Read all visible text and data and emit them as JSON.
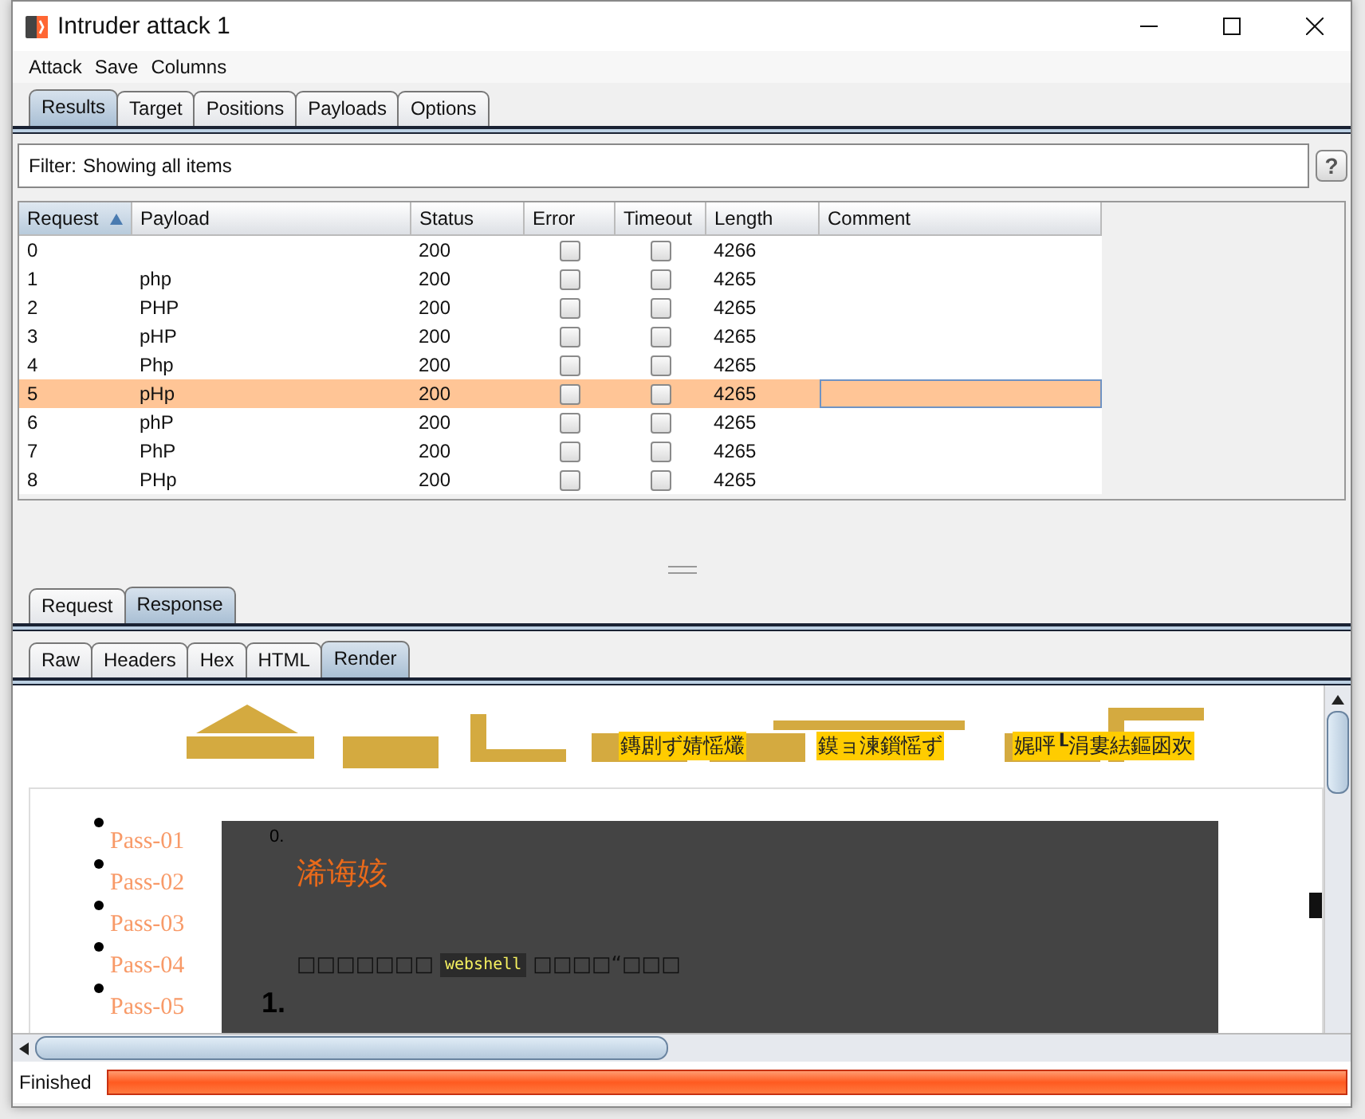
{
  "window": {
    "title": "Intruder attack 1"
  },
  "menu": [
    "Attack",
    "Save",
    "Columns"
  ],
  "tabs": [
    {
      "label": "Results",
      "selected": true
    },
    {
      "label": "Target",
      "selected": false
    },
    {
      "label": "Positions",
      "selected": false
    },
    {
      "label": "Payloads",
      "selected": false
    },
    {
      "label": "Options",
      "selected": false
    }
  ],
  "filter": {
    "label": "Filter:",
    "value": "Showing all items",
    "help": "?"
  },
  "table": {
    "columns": [
      {
        "label": "Request",
        "sorted": true
      },
      {
        "label": "Payload",
        "sorted": false
      },
      {
        "label": "Status",
        "sorted": false
      },
      {
        "label": "Error",
        "sorted": false
      },
      {
        "label": "Timeout",
        "sorted": false
      },
      {
        "label": "Length",
        "sorted": false
      },
      {
        "label": "Comment",
        "sorted": false
      }
    ],
    "rows": [
      {
        "request": "0",
        "status": "200",
        "error": false,
        "timeout": false,
        "length": "4266",
        "selected": false
      },
      {
        "request": "1",
        "payload": "php",
        "status": "200",
        "error": false,
        "timeout": false,
        "length": "4265",
        "selected": false
      },
      {
        "request": "2",
        "payload": "PHP",
        "status": "200",
        "error": false,
        "timeout": false,
        "length": "4265",
        "selected": false
      },
      {
        "request": "3",
        "payload": "pHP",
        "status": "200",
        "error": false,
        "timeout": false,
        "length": "4265",
        "selected": false
      },
      {
        "request": "4",
        "payload": "Php",
        "status": "200",
        "error": false,
        "timeout": false,
        "length": "4265",
        "selected": false
      },
      {
        "request": "5",
        "payload": "pHp",
        "status": "200",
        "error": false,
        "timeout": false,
        "length": "4265",
        "selected": true
      },
      {
        "request": "6",
        "payload": "phP",
        "status": "200",
        "error": false,
        "timeout": false,
        "length": "4265",
        "selected": false
      },
      {
        "request": "7",
        "payload": "PhP",
        "status": "200",
        "error": false,
        "timeout": false,
        "length": "4265",
        "selected": false
      },
      {
        "request": "8",
        "payload": "PHp",
        "status": "200",
        "error": false,
        "timeout": false,
        "length": "4265",
        "selected": false
      }
    ]
  },
  "message_tabs": [
    {
      "label": "Request",
      "selected": false
    },
    {
      "label": "Response",
      "selected": true
    }
  ],
  "view_tabs": [
    {
      "label": "Raw",
      "selected": false
    },
    {
      "label": "Headers",
      "selected": false
    },
    {
      "label": "Hex",
      "selected": false
    },
    {
      "label": "HTML",
      "selected": false
    },
    {
      "label": "Render",
      "selected": true
    }
  ],
  "render": {
    "logo_links": [
      "鏄剧ず婧愮爜",
      "鏌ョ湅鎻愮ず",
      "娓呯┖涓婁紶鏂囦欢"
    ],
    "nav_items": [
      "Pass-01",
      "Pass-02",
      "Pass-03",
      "Pass-04",
      "Pass-05"
    ],
    "panel": {
      "index": "0.",
      "heading": "浠诲姟",
      "text_before": "□□□□□□□",
      "code": "webshell",
      "text_after": "□□□□“□□□",
      "next_index": "1."
    }
  },
  "status_bar": {
    "text": "Finished",
    "progress": {
      "level": 1
    }
  }
}
